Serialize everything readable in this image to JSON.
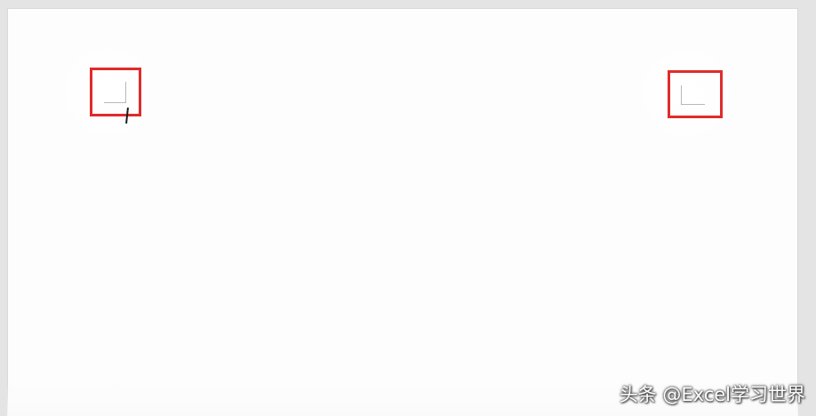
{
  "page": {
    "background_color": "#fdfdfd",
    "frame_color": "#e4e4e4"
  },
  "highlights": {
    "color": "#e02b2b",
    "left_icon": "page-corner-mark-icon",
    "right_icon": "page-corner-mark-icon"
  },
  "watermark": {
    "text": "头条 @Excel学习世界"
  }
}
